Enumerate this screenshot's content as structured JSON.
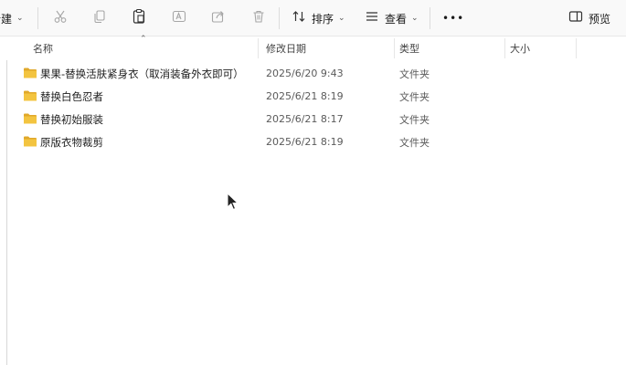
{
  "toolbar": {
    "new_label": "新建",
    "sort_label": "排序",
    "view_label": "查看",
    "more_label": "•••",
    "preview_label": "预览"
  },
  "columns": {
    "name": "名称",
    "modified": "修改日期",
    "type": "类型",
    "size": "大小"
  },
  "files": [
    {
      "name": "果果-替换活肤紧身衣（取消装备外衣即可）",
      "modified": "2025/6/20 9:43",
      "type": "文件夹",
      "size": ""
    },
    {
      "name": "替换白色忍者",
      "modified": "2025/6/21 8:19",
      "type": "文件夹",
      "size": ""
    },
    {
      "name": "替换初始服装",
      "modified": "2025/6/21 8:17",
      "type": "文件夹",
      "size": ""
    },
    {
      "name": "原版衣物裁剪",
      "modified": "2025/6/21 8:19",
      "type": "文件夹",
      "size": ""
    }
  ],
  "colors": {
    "folder": "#f3c440",
    "folder_dark": "#e0a82a",
    "accent": "#0067c0"
  },
  "icons": [
    "cut-icon",
    "copy-icon",
    "paste-icon",
    "rename-icon",
    "share-icon",
    "delete-icon",
    "sort-icon",
    "view-icon",
    "preview-pane-icon",
    "folder-icon"
  ]
}
